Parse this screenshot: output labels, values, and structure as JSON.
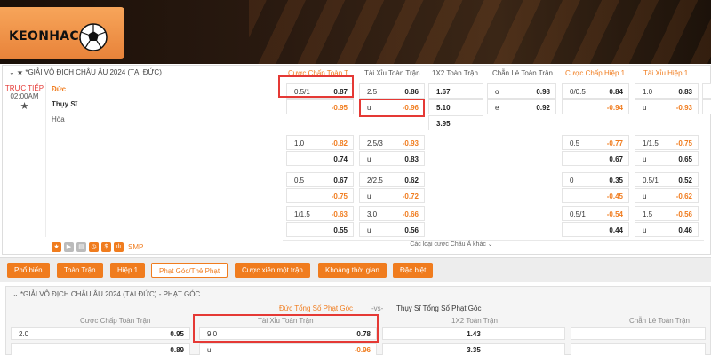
{
  "brand": {
    "logo_text": "KEONHACAI",
    "accent": "#f07c1e",
    "alert": "#e53935"
  },
  "league": {
    "title": "*GIẢI VÔ ĐỊCH CHÂU ÂU 2024 (TẠI ĐỨC)",
    "columns": [
      "Cược Chấp Toàn T",
      "Tài Xỉu Toàn Trận",
      "1X2 Toàn Trận",
      "Chẵn Lẻ Toàn Trận",
      "Cược Chấp Hiệp 1",
      "Tài Xỉu Hiệp 1"
    ]
  },
  "match": {
    "status": "TRỰC TIẾP",
    "time": "02:00AM",
    "home": "Đức",
    "away": "Thụy Sĩ",
    "draw": "Hòa"
  },
  "odds": {
    "main": {
      "ah": {
        "line": "0.5/1",
        "home": "0.87",
        "away": "-0.95"
      },
      "ou": {
        "line": "2.5",
        "over": "0.86",
        "u": "u",
        "under": "-0.96"
      },
      "x12": {
        "home": "1.67",
        "away": "5.10",
        "draw": "3.95"
      },
      "oe": {
        "o": "o",
        "o_val": "0.98",
        "e": "e",
        "e_val": "0.92"
      },
      "ah_h1": {
        "line": "0/0.5",
        "home": "0.84",
        "away": "-0.94"
      },
      "ou_h1": {
        "line": "1.0",
        "over": "0.83",
        "u": "u",
        "under": "-0.93"
      }
    },
    "alt": [
      {
        "ah_line": "1.0",
        "ah_home": "-0.82",
        "ah_away": "0.74",
        "ou_line": "2.5/3",
        "ou_over": "-0.93",
        "ou_u": "u",
        "ou_under": "0.83",
        "h1_ah_line": "0.5",
        "h1_ah_home": "-0.77",
        "h1_ah_away": "0.67",
        "h1_ou_line": "1/1.5",
        "h1_ou_over": "-0.75",
        "h1_ou_u": "u",
        "h1_ou_under": "0.65"
      },
      {
        "ah_line": "0.5",
        "ah_home": "0.67",
        "ah_away": "-0.75",
        "ou_line": "2/2.5",
        "ou_over": "0.62",
        "ou_u": "u",
        "ou_under": "-0.72",
        "h1_ah_line": "0",
        "h1_ah_home": "0.35",
        "h1_ah_away": "-0.45",
        "h1_ou_line": "0.5/1",
        "h1_ou_over": "0.52",
        "h1_ou_u": "u",
        "h1_ou_under": "-0.62"
      },
      {
        "ah_line": "1/1.5",
        "ah_home": "-0.63",
        "ah_away": "0.55",
        "ou_line": "3.0",
        "ou_over": "-0.66",
        "ou_u": "u",
        "ou_under": "0.56",
        "h1_ah_line": "0.5/1",
        "h1_ah_home": "-0.54",
        "h1_ah_away": "0.44",
        "h1_ou_line": "1.5",
        "h1_ou_over": "-0.56",
        "h1_ou_u": "u",
        "h1_ou_under": "0.46"
      }
    ],
    "more_label": "Các loại cược Châu Á khác ⌄"
  },
  "iconbar": {
    "smp": "SMP"
  },
  "tabs": [
    "Phổ biến",
    "Toàn Trận",
    "Hiệp 1",
    "Phạt Góc/Thẻ Phạt",
    "Cược xiên một trận",
    "Khoảng thời gian",
    "Đặc biệt"
  ],
  "corners": {
    "title": "*GIẢI VÔ ĐỊCH CHÂU ÂU 2024 (TẠI ĐỨC) - PHẠT GÓC",
    "home_total": "Đức Tổng Số Phạt Góc",
    "vs": "-vs-",
    "away_total": "Thụy Sĩ Tổng Số Phạt Góc",
    "col_ah": "Cược Chấp Toàn Trận",
    "col_ou": "Tài Xỉu Toàn Trận",
    "col_x12": "1X2 Toàn Trận",
    "col_oe": "Chẵn Lẻ Toàn Trận",
    "ah_line": "2.0",
    "ah_home": "0.95",
    "ah_away": "0.89",
    "ou_line": "9.0",
    "ou_over": "0.78",
    "ou_u": "u",
    "ou_under": "-0.96",
    "x12_home": "1.43",
    "x12_away": "3.35"
  }
}
